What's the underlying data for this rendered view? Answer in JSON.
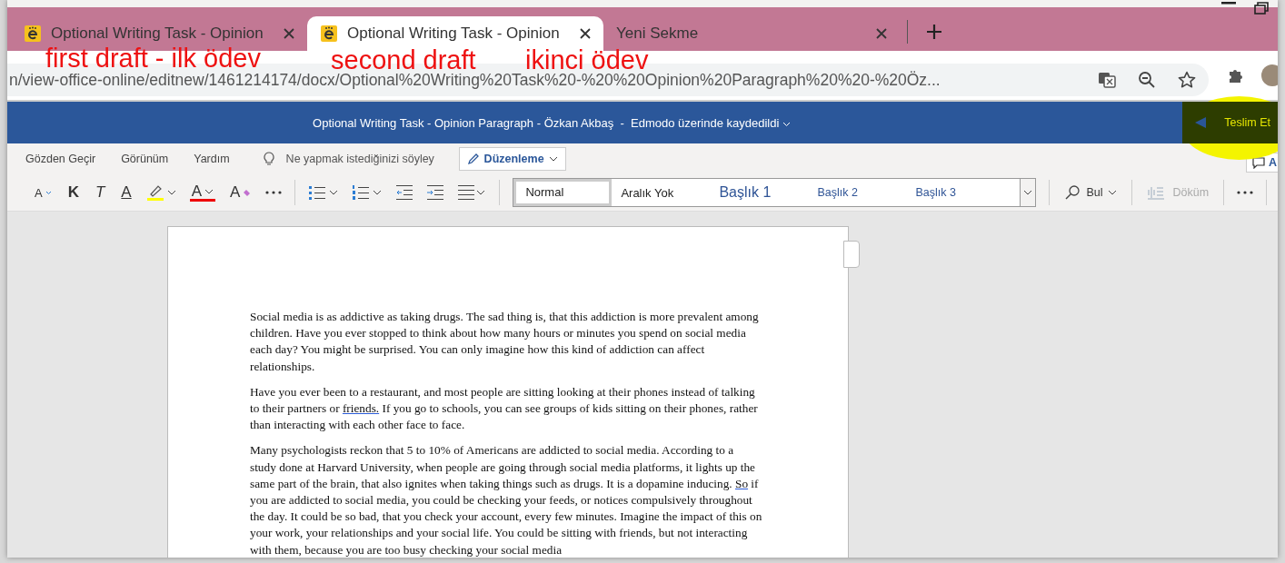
{
  "tabs": [
    {
      "kind": "site",
      "title": "Optional Writing Task - Opinion",
      "selected": false
    },
    {
      "kind": "site",
      "title": "Optional Writing Task - Opinion",
      "selected": true
    },
    {
      "kind": "blank",
      "title": "Yeni Sekme",
      "selected": false
    }
  ],
  "annotations": [
    {
      "text": "first draft - ilk ödev"
    },
    {
      "text": "second draft"
    },
    {
      "text": "ikinci ödev"
    }
  ],
  "address": {
    "url": "n/view-office-online/editnew/1461214174/docx/Optional%20Writing%20Task%20-%20%20Opinion%20Paragraph%20%20-%20Öz..."
  },
  "doc_bar": {
    "title": "Optional Writing Task - Opinion Paragraph - Özkan Akbaş  -  Edmodo üzerinde kaydedildi",
    "submit": "Teslim Et"
  },
  "ribbon_tabs": [
    "Gözden Geçir",
    "Görünüm",
    "Yardım"
  ],
  "tell_me": {
    "placeholder": "Ne yapmak istediğinizi söyley"
  },
  "mode_button": "Düzenleme",
  "comments_button": "A",
  "toolbar": [
    {
      "kind": "shrink",
      "label": "A"
    },
    {
      "kind": "bold",
      "label": "K"
    },
    {
      "kind": "italic",
      "label": "T"
    },
    {
      "kind": "underline",
      "label": "A"
    },
    {
      "kind": "highlight"
    },
    {
      "kind": "fontcolor",
      "label": "A"
    },
    {
      "kind": "clear",
      "label": "A"
    },
    {
      "kind": "more"
    },
    {
      "kind": "separator"
    },
    {
      "kind": "bullets"
    },
    {
      "kind": "numbering"
    },
    {
      "kind": "outdent"
    },
    {
      "kind": "indent"
    },
    {
      "kind": "align"
    }
  ],
  "styles": [
    {
      "kind": "normal",
      "label": "Normal",
      "selected": true
    },
    {
      "kind": "plain",
      "label": "Aralık Yok",
      "selected": false
    },
    {
      "kind": "h1",
      "label": "Başlık 1",
      "selected": false
    },
    {
      "kind": "h2",
      "label": "Başlık 2",
      "selected": false
    },
    {
      "kind": "h3",
      "label": "Başlık 3",
      "selected": false
    }
  ],
  "find": "Bul",
  "dictate": {
    "label": "Döküm",
    "disabled": true
  },
  "paragraphs": [
    [
      {
        "text": "Social media is as addictive as taking drugs. The sad thing is, that this addiction is more prevalent among children. Have you ever stopped to think about how many hours or minutes you spend on social media each day? You might be surprised. You can only imagine how this kind of addiction can affect relationships.",
        "flagged": false
      }
    ],
    [
      {
        "text": "Have you ever been to a restaurant, and most people are sitting looking at their phones instead of talking to their partners or ",
        "flagged": false
      },
      {
        "text": "friends.",
        "flagged": true
      },
      {
        "text": " If you go to schools, you can see groups of kids sitting on their phones, rather than interacting with each other face to face.",
        "flagged": false
      }
    ],
    [
      {
        "text": "Many psychologists reckon that 5 to 10% of Americans are addicted to social media. According to a study done at Harvard University, when people are going through social media platforms, it lights up the same part of the brain, that also ignites when taking things such as drugs. It is a dopamine inducing. ",
        "flagged": false
      },
      {
        "text": "So",
        "flagged": true
      },
      {
        "text": " if you are addicted to social media, you could be checking your feeds, or notices compulsively throughout the day. It could be so bad, that you check your account, every few minutes. Imagine the impact of this on your work, your relationships and your social life. You could be sitting with friends, but not interacting with them, because you are too busy checking your social media",
        "flagged": false
      }
    ]
  ]
}
